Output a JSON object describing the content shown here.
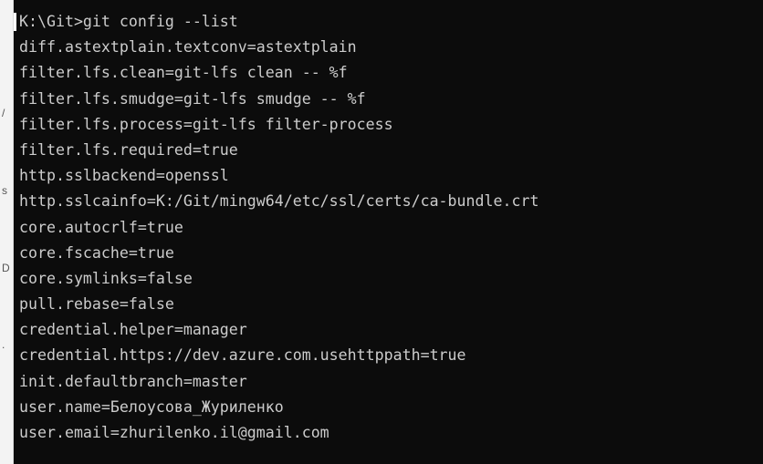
{
  "terminal": {
    "colors": {
      "background": "#0c0c0c",
      "foreground": "#cccccc"
    },
    "lines": [
      "K:\\Git>git config --list",
      "diff.astextplain.textconv=astextplain",
      "filter.lfs.clean=git-lfs clean -- %f",
      "filter.lfs.smudge=git-lfs smudge -- %f",
      "filter.lfs.process=git-lfs filter-process",
      "filter.lfs.required=true",
      "http.sslbackend=openssl",
      "http.sslcainfo=K:/Git/mingw64/etc/ssl/certs/ca-bundle.crt",
      "core.autocrlf=true",
      "core.fscache=true",
      "core.symlinks=false",
      "pull.rebase=false",
      "credential.helper=manager",
      "credential.https://dev.azure.com.usehttppath=true",
      "init.defaultbranch=master",
      "user.name=Белоусова_Журиленко",
      "user.email=zhurilenko.il@gmail.com"
    ]
  },
  "behind_window": {
    "glyphs": [
      "/",
      "s",
      "D",
      "."
    ]
  }
}
